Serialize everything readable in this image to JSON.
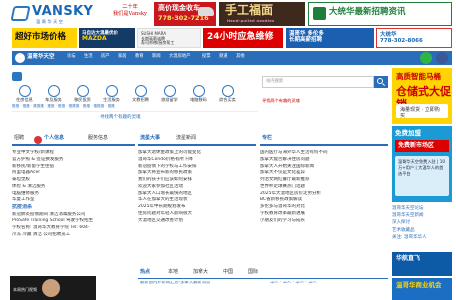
{
  "header": {
    "logo_text": "VANSKY",
    "logo_sub": "温哥华天空",
    "slogan_line1": "二十年",
    "slogan_line2": "我们是Vansky"
  },
  "top_ads": {
    "ad1_line1": "高价现金收车",
    "ad1_line2": "778-302-7216",
    "ad2_main": "手工福面",
    "ad2_sub": "Hand-pulled noodles",
    "ad3_main": "大统华最新招聘资讯"
  },
  "row_ads": {
    "r1": "超好市场价格",
    "r2_small": "马自达大温最优价",
    "r2_big": "MAZDA",
    "r3_line1": "SUSHI MARA",
    "r3_line2": "长期高薪诚聘",
    "r3_line3": "寿司师傅/厨房帮工",
    "r4": "24小时应急维修",
    "r5_line1": "温哥华 多伦多",
    "r5_line2": "长期高薪招聘",
    "r6_line1": "大统华",
    "r6_line2": "778-302-8066"
  },
  "nav": {
    "title": "温哥华天空",
    "items": [
      "论坛",
      "生活",
      "房产",
      "家居",
      "教育",
      "新闻",
      "大温房地产",
      "投票",
      "频道",
      "其他"
    ]
  },
  "categories": [
    "住房信息",
    "车及服务",
    "移民投资",
    "生活服务",
    "文教招聘",
    "旅游留学",
    "电脑数码",
    "综合买卖"
  ],
  "subline": "推推 · 推推 · 推推推 · 推推 · 推推 · 推推推 · 推推 · 推推推 · 推推",
  "search": {
    "placeholder": "站内搜索",
    "button": "搜索",
    "hint": "寻找两个有趣的灵魂"
  },
  "big_ad": {
    "b1": "高质智能马桶",
    "b2": "仓储式大促销",
    "b3": "海量现货 · 立即购买"
  },
  "promo_ad": {
    "p1": "免费加盟",
    "p2": "免费新市场区",
    "p3": "温哥华天空免费入驻 | 10万+用户 | 大温华人的首选平台"
  },
  "find_link": "寻找两个有趣的灵魂",
  "columns": {
    "c1": {
      "tab1": "招聘",
      "tab2": "个人信息",
      "tab3": "服务信息",
      "items": [
        "专业中文学校/新课程",
        "官方护照 & 签证换发服务",
        "新移民/新留学生住宿",
        "阿里电器Acer",
        "泰坦塑胶",
        "体检 & 清洁服务",
        "电脑维修服务",
        "华夏工作室",
        "抗疫消杀"
      ],
      "h1": "抗疫消杀",
      "lines": [
        "新冠肺炎疫情期间 清洁消毒服务公司",
        "ProSafe Training School 驾驶学校招生",
        "学校名称: 温哥华大教育学院 Tel: 604-",
        "冷冻 冷藏 清洁 公司招聘员工"
      ]
    },
    "c2": {
      "tab1": "流星大事",
      "tab2": "流星新闻",
      "items": [
        "加拿大退休金政策上的可能变化",
        "温哥华Condo价格有所下降",
        "新冠疫情下的学校与工作安排",
        "加拿大将宣布新的移民政策",
        "我们的孩子们应该如何安排",
        "欢迎大家参加社区活动",
        "加拿大人口增长最快的地区",
        "华人在加拿大的生活现状",
        "2025年中长期规划发布",
        "住房问题对年轻人影响很大",
        "大温地区交通改善计划"
      ]
    },
    "c3": {
      "tab1": "专栏",
      "items": [
        "国内医疗与海外华人生活有何不同",
        "加拿大能否解决住房问题",
        "加拿大人开始关注国际新闻",
        "加拿大不仅是文化差异",
        "列治文网红餐厅最新推荐",
        "世界杯足球赛热门话题",
        "2025年大温地区房价走势分析",
        "BC省新移民政策解读",
        "多伦多与温哥华的对比",
        "学校教育改革最新进展",
        "小朋友们的学习与成长"
      ]
    },
    "right_list": [
      "温哥华天空论坛",
      "温哥华天空新闻",
      "深入探讨",
      "艺术收藏品",
      "关注: 温哥华华人",
      "温哥华汽车",
      "温哥华房产",
      "温哥华天空"
    ]
  },
  "bottom_tabs": {
    "tabs": [
      "热点",
      "本地",
      "加拿大",
      "中国",
      "国际"
    ],
    "news": [
      "最新国内外新闻汇总-加拿大最新消息",
      "华人 · 华人 · 华人 · 华人"
    ]
  },
  "photo": {
    "caption": "本周热门视频"
  },
  "chip_ads": {
    "c1": "华航直飞",
    "c2": "温哥华商业机会"
  }
}
